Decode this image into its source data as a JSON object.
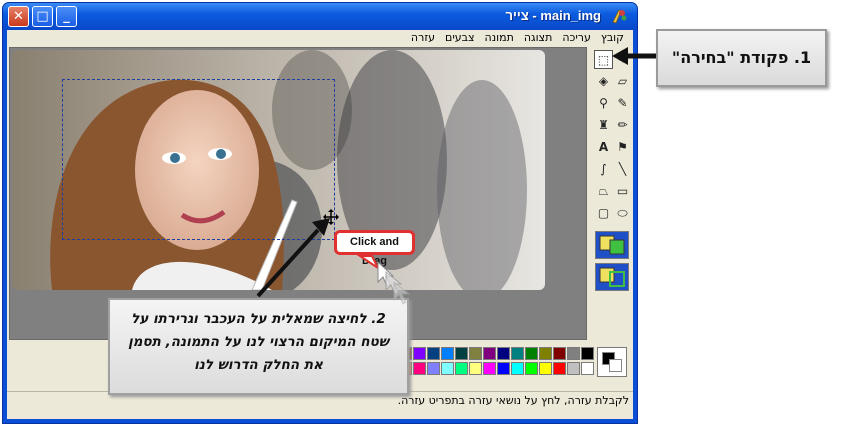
{
  "window": {
    "title": "main_img - צייר",
    "close_glyph": "✕",
    "max_glyph": "□",
    "min_glyph": "_"
  },
  "menu": {
    "items": [
      {
        "label": "קובץ"
      },
      {
        "label": "עריכה"
      },
      {
        "label": "תצוגה"
      },
      {
        "label": "תמונה"
      },
      {
        "label": "צבעים"
      },
      {
        "label": "עזרה"
      }
    ]
  },
  "toolbox": {
    "tools": [
      {
        "name": "free-select-icon",
        "glyph": "✶"
      },
      {
        "name": "rect-select-icon",
        "glyph": "⬚"
      },
      {
        "name": "eraser-icon",
        "glyph": "▱"
      },
      {
        "name": "fill-icon",
        "glyph": "◈"
      },
      {
        "name": "eyedropper-icon",
        "glyph": "✎"
      },
      {
        "name": "magnifier-icon",
        "glyph": "⚲"
      },
      {
        "name": "pencil-icon",
        "glyph": "✏"
      },
      {
        "name": "brush-icon",
        "glyph": "♜"
      },
      {
        "name": "airbrush-icon",
        "glyph": "⚑"
      },
      {
        "name": "text-icon",
        "glyph": "A"
      },
      {
        "name": "line-icon",
        "glyph": "╲"
      },
      {
        "name": "curve-icon",
        "glyph": "∫"
      },
      {
        "name": "rectangle-icon",
        "glyph": "▭"
      },
      {
        "name": "polygon-icon",
        "glyph": "⏢"
      },
      {
        "name": "ellipse-icon",
        "glyph": "⬭"
      },
      {
        "name": "rounded-rect-icon",
        "glyph": "▢"
      }
    ]
  },
  "palette": {
    "row1": [
      "#000000",
      "#808080",
      "#800000",
      "#808000",
      "#008000",
      "#008080",
      "#000080",
      "#800080",
      "#808040",
      "#004040",
      "#0080ff",
      "#004080",
      "#8000ff",
      "#804000"
    ],
    "row2": [
      "#ffffff",
      "#c0c0c0",
      "#ff0000",
      "#ffff00",
      "#00ff00",
      "#00ffff",
      "#0000ff",
      "#ff00ff",
      "#ffff80",
      "#00ff80",
      "#80ffff",
      "#8080ff",
      "#ff0080",
      "#ff8040"
    ]
  },
  "status": {
    "text": "לקבלת עזרה, לחץ על נושאי עזרה בתפריט עזרה."
  },
  "callouts": {
    "step1": "1. פקודת \"בחירה\"",
    "step2_line1": "2.  לחיצה שמאלית על העכבר וגרירתו על",
    "step2_line2": "שטח המיקום הרצוי לנו על התמונה, תסמן",
    "step2_line3": "את החלק הדרוש לנו",
    "drag_label": "Click and Drag"
  },
  "colors": {
    "titlebar": "#0c5be0",
    "window_bg": "#ece9d8",
    "canvas_bg": "#808080",
    "drag_border": "#e03030"
  }
}
